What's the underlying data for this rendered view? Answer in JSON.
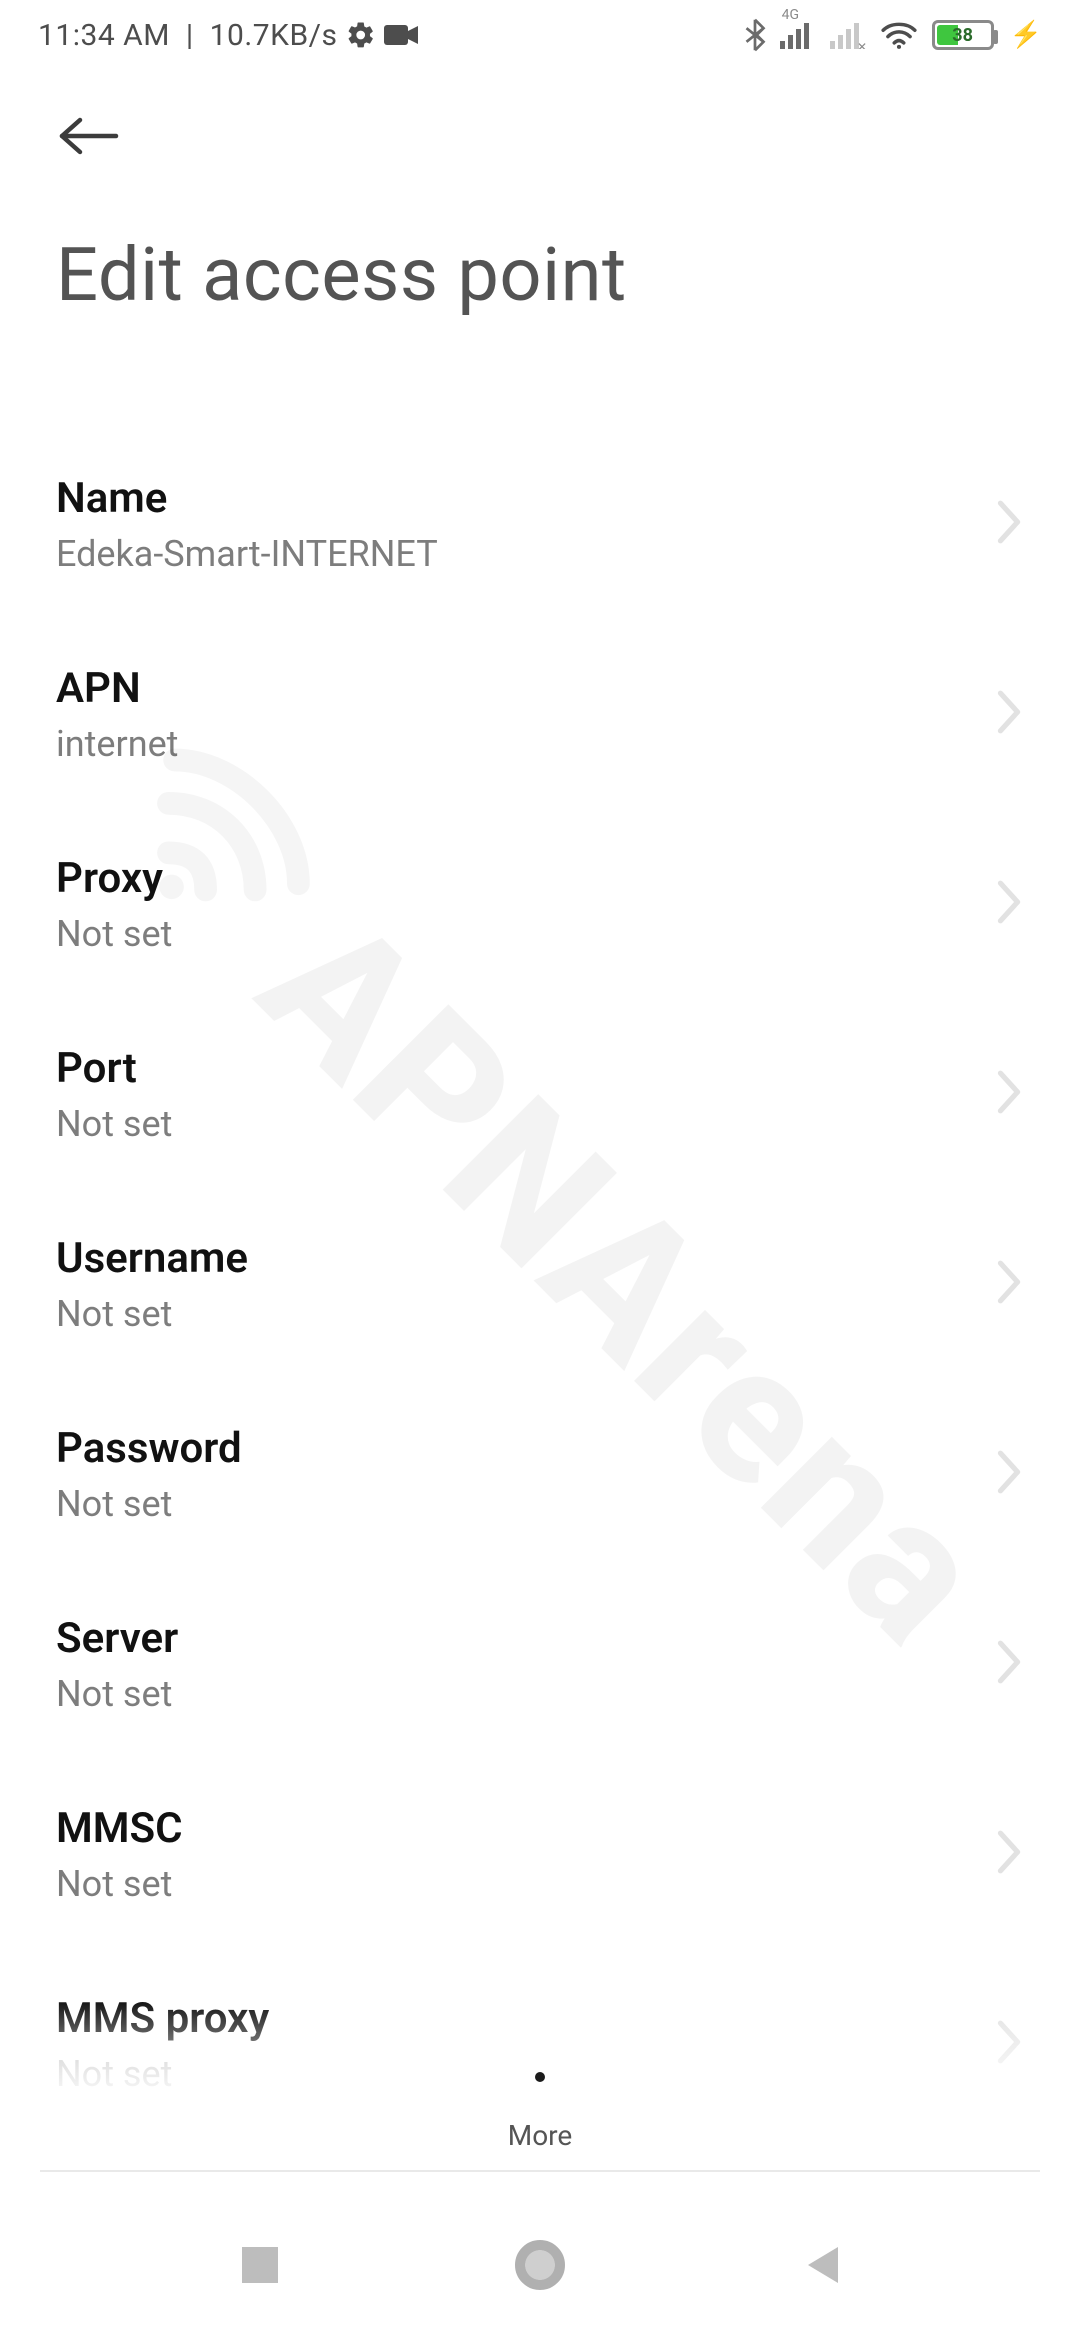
{
  "status": {
    "time": "11:34 AM",
    "net_speed": "10.7KB/s",
    "signal_label_4g": "4G",
    "battery_pct": 38,
    "battery_pct_text": "38"
  },
  "header": {
    "title": "Edit access point"
  },
  "rows": [
    {
      "label": "Name",
      "value": "Edeka-Smart-INTERNET"
    },
    {
      "label": "APN",
      "value": "internet"
    },
    {
      "label": "Proxy",
      "value": "Not set"
    },
    {
      "label": "Port",
      "value": "Not set"
    },
    {
      "label": "Username",
      "value": "Not set"
    },
    {
      "label": "Password",
      "value": "Not set"
    },
    {
      "label": "Server",
      "value": "Not set"
    },
    {
      "label": "MMSC",
      "value": "Not set"
    },
    {
      "label": "MMS proxy",
      "value": "Not set"
    }
  ],
  "bottom": {
    "more_label": "More"
  },
  "watermark": {
    "text": "APNArena"
  }
}
